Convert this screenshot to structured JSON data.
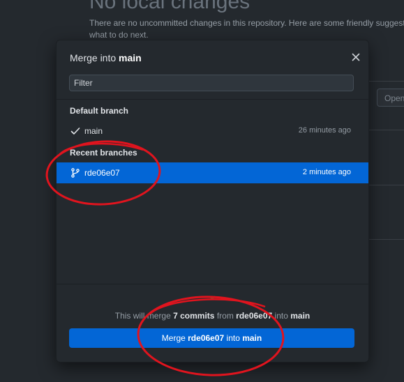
{
  "background": {
    "heading": "No local changes",
    "description_line1": "There are no uncommitted changes in this repository. Here are some friendly suggest",
    "description_line2": "what to do next.",
    "open_button_label": "Open"
  },
  "dialog": {
    "title_prefix": "Merge into ",
    "title_branch": "main",
    "close_icon": "close-icon",
    "filter_placeholder": "Filter",
    "filter_value": "",
    "sections": {
      "default_branch": {
        "header": "Default branch",
        "items": [
          {
            "name": "main",
            "time": "26 minutes ago",
            "icon": "check-icon",
            "selected": false
          }
        ]
      },
      "recent_branches": {
        "header": "Recent branches",
        "items": [
          {
            "name": "rde06e07",
            "time": "2 minutes ago",
            "icon": "git-branch-icon",
            "selected": true
          }
        ]
      }
    },
    "summary": {
      "prefix": "This will merge ",
      "commits": "7 commits",
      "from_word": " from ",
      "source": "rde06e07",
      "into_word": " into ",
      "target": "main"
    },
    "merge_button": {
      "prefix": "Merge ",
      "source": "rde06e07",
      "into_word": " into ",
      "target": "main"
    }
  },
  "colors": {
    "accent": "#0366d6",
    "annotation": "#e0141e",
    "background": "#24292e"
  }
}
